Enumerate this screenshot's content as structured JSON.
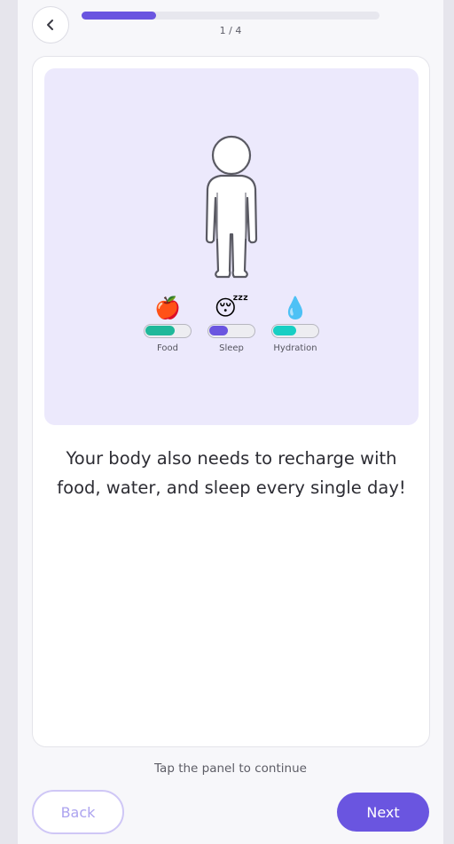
{
  "header": {
    "back_icon": "chevron-left-icon",
    "progress_value": 0.25,
    "step_text": "1 / 4"
  },
  "illustration": {
    "figure_icon": "body-outline-icon",
    "meters": [
      {
        "emoji": "🍎",
        "label": "Food",
        "value": 0.64,
        "color": "#1fb89a"
      },
      {
        "emoji": "😴",
        "label": "Sleep",
        "value": 0.4,
        "color": "#6a55e0"
      },
      {
        "emoji": "💧",
        "label": "Hydration",
        "value": 0.5,
        "color": "#18cfc4"
      }
    ]
  },
  "caption": "Your body also needs to recharge with food, water, and sleep every single day!",
  "hint": "Tap the panel to continue",
  "footer": {
    "back_label": "Back",
    "next_label": "Next"
  },
  "colors": {
    "accent": "#6a55e0",
    "panel_bg": "#ece9fc"
  }
}
